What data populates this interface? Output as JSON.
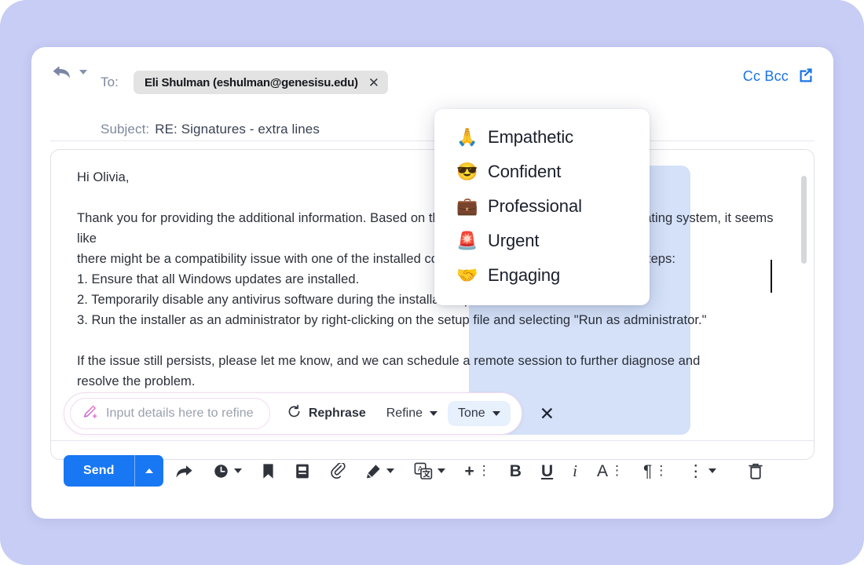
{
  "window": {
    "reply_icon": "reply-arrow-icon",
    "reply_caret_icon": "chevron-down-icon"
  },
  "header": {
    "to_label": "To:",
    "recipient": "Eli Shulman (eshulman@genesisu.edu)",
    "recipient_remove_icon": "close-icon",
    "subject_label": "Subject:",
    "subject_value": "RE: Signatures - extra lines",
    "cc_bcc_label": "Cc Bcc",
    "popout_icon": "external-link-icon"
  },
  "body": {
    "text": "Hi Olivia,\n\nThank you for providing the additional information. Based on the details you shared about the operating system, it seems like\nthere might be a compatibility issue with one of the installed components. Please try the following steps:\n1. Ensure that all Windows updates are installed.\n2. Temporarily disable any antivirus software during the installation process.\n3. Run the installer as an administrator by right-clicking on the setup file and selecting \"Run as administrator.\"\n\nIf the issue still persists, please let me know, and we can schedule a remote session to further diagnose and\nresolve the problem.",
    "scrollbar_name": "body-scrollbar"
  },
  "tone_dropdown": {
    "items": [
      {
        "emoji": "🙏",
        "label": "Empathetic",
        "icon": "praying-hands-emoji"
      },
      {
        "emoji": "😎",
        "label": "Confident",
        "icon": "sunglasses-face-emoji"
      },
      {
        "emoji": "💼",
        "label": "Professional",
        "icon": "briefcase-emoji"
      },
      {
        "emoji": "🚨",
        "label": "Urgent",
        "icon": "siren-emoji"
      },
      {
        "emoji": "🤝",
        "label": "Engaging",
        "icon": "handshake-emoji"
      }
    ]
  },
  "refine_bar": {
    "input_placeholder": "Input details here to refine",
    "input_value": "",
    "magic_icon": "magic-pen-icon",
    "rephrase_label": "Rephrase",
    "rephrase_icon": "refresh-icon",
    "refine_label": "Refine",
    "tone_label": "Tone",
    "close_icon": "close-icon",
    "active_button": "Tone"
  },
  "toolbar": {
    "send_label": "Send",
    "send_caret_icon": "chevron-up-icon",
    "items": [
      {
        "name": "forward-icon",
        "glyph": ""
      },
      {
        "name": "schedule-clock-icon",
        "glyph": ""
      },
      {
        "name": "bookmark-icon",
        "glyph": ""
      },
      {
        "name": "template-book-icon",
        "glyph": ""
      },
      {
        "name": "attachment-paperclip-icon",
        "glyph": ""
      },
      {
        "name": "signature-pen-icon",
        "glyph": ""
      },
      {
        "name": "translate-icon",
        "glyph": ""
      },
      {
        "name": "insert-plus-icon",
        "glyph": "+"
      },
      {
        "name": "bold-icon",
        "glyph": "B"
      },
      {
        "name": "underline-icon",
        "glyph": "U"
      },
      {
        "name": "italic-icon",
        "glyph": "i"
      },
      {
        "name": "font-style-icon",
        "glyph": "A"
      },
      {
        "name": "paragraph-icon",
        "glyph": "¶"
      },
      {
        "name": "more-options-icon",
        "glyph": "⋮"
      },
      {
        "name": "delete-trash-icon",
        "glyph": ""
      }
    ]
  },
  "colors": {
    "backdrop": "#c7cdf5",
    "accent_blue": "#1877f2",
    "link_blue": "#1a73e8",
    "selection_blue": "#ccdcf7",
    "tone_active_bg": "#e7f0fd",
    "magic_pink": "#e06fd0"
  }
}
